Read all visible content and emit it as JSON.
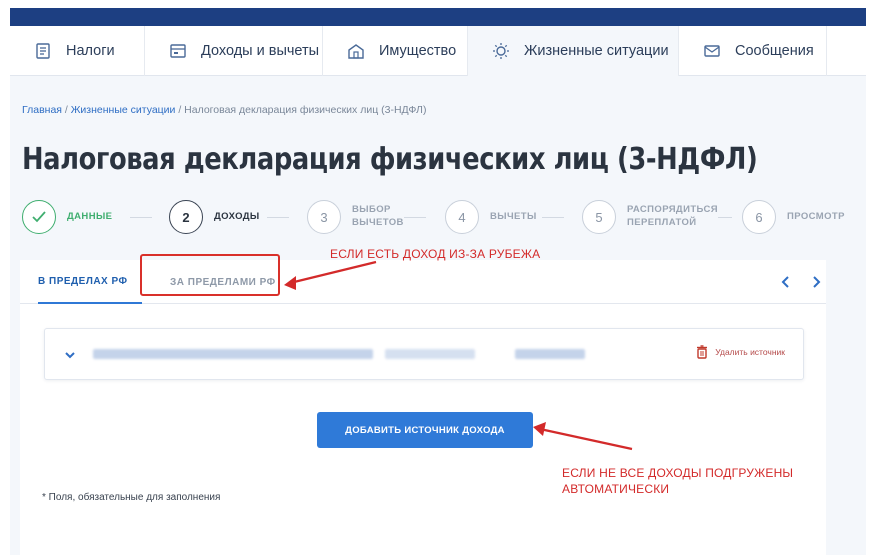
{
  "nav": {
    "items": [
      {
        "label": "Налоги",
        "icon": "tax-icon",
        "active": false
      },
      {
        "label": "Доходы и вычеты",
        "icon": "income-icon",
        "active": false
      },
      {
        "label": "Имущество",
        "icon": "property-icon",
        "active": false
      },
      {
        "label": "Жизненные ситуации",
        "icon": "life-situations-icon",
        "active": true
      },
      {
        "label": "Сообщения",
        "icon": "messages-icon",
        "active": false
      }
    ]
  },
  "breadcrumb": {
    "home": "Главная",
    "sep1": " / ",
    "section": "Жизненные ситуации",
    "sep2": " / ",
    "current": "Налоговая декларация физических лиц (3-НДФЛ)"
  },
  "page_title": "Налоговая декларация физических лиц (3-НДФЛ)",
  "stepper": {
    "steps": [
      {
        "num": "",
        "label": "ДАННЫЕ",
        "state": "done"
      },
      {
        "num": "2",
        "label": "ДОХОДЫ",
        "state": "current"
      },
      {
        "num": "3",
        "label": "ВЫБОР\nВЫЧЕТОВ",
        "state": "pending"
      },
      {
        "num": "4",
        "label": "ВЫЧЕТЫ",
        "state": "pending"
      },
      {
        "num": "5",
        "label": "РАСПОРЯДИТЬСЯ\nПЕРЕПЛАТОЙ",
        "state": "pending"
      },
      {
        "num": "6",
        "label": "ПРОСМОТР",
        "state": "pending"
      }
    ]
  },
  "tabs": {
    "domestic": "В ПРЕДЕЛАХ РФ",
    "foreign": "ЗА ПРЕДЕЛАМИ РФ"
  },
  "source": {
    "delete_label": "Удалить источник"
  },
  "add_button": "ДОБАВИТЬ ИСТОЧНИК ДОХОДА",
  "required_note": "* Поля, обязательные для заполнения",
  "annotations": {
    "foreign_income": "ЕСЛИ ЕСТЬ ДОХОД ИЗ-ЗА РУБЕЖА",
    "not_loaded_line1": "ЕСЛИ НЕ ВСЕ ДОХОДЫ ПОДГРУЖЕНЫ",
    "not_loaded_line2": "АВТОМАТИЧЕСКИ"
  },
  "colors": {
    "topbar": "#1d3f82",
    "accent": "#2f7ad8",
    "done": "#3fae6f",
    "annotation": "#d32a2a",
    "delete": "#b54a4a"
  }
}
